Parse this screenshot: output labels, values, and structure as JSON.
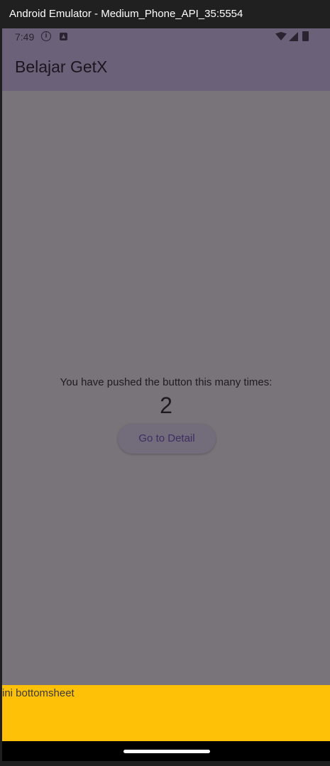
{
  "window": {
    "title": "Android Emulator - Medium_Phone_API_35:5554"
  },
  "status_bar": {
    "time": "7:49",
    "icons": [
      "info-icon",
      "app-notification-icon",
      "wifi-icon",
      "signal-icon",
      "battery-icon"
    ]
  },
  "app_bar": {
    "title": "Belajar GetX"
  },
  "main": {
    "counter_label": "You have pushed the button this many times:",
    "counter_value": "2",
    "detail_button_label": "Go to Detail"
  },
  "bottom_sheet": {
    "text": "ini bottomsheet"
  },
  "colors": {
    "app_bar": "#6b6178",
    "scrim_body": "#79747a",
    "bottom_sheet": "#ffc107"
  }
}
